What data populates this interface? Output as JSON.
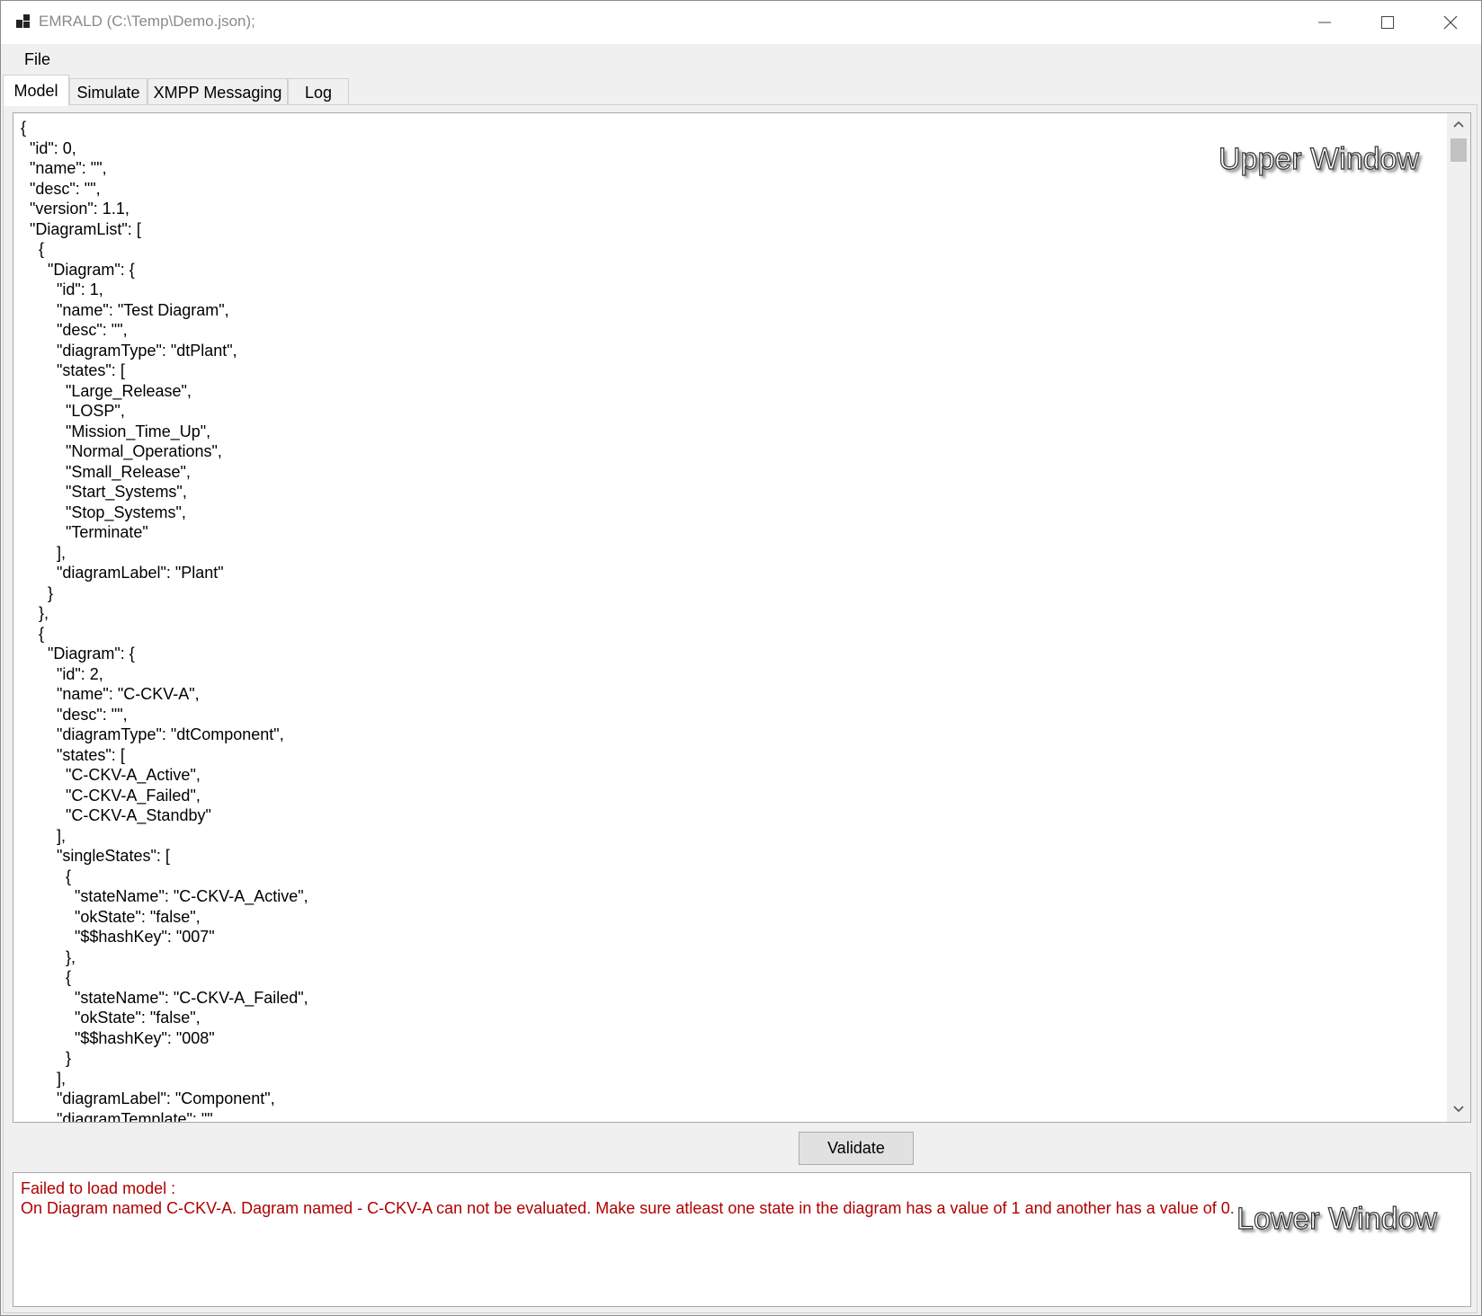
{
  "window": {
    "title": "EMRALD (C:\\Temp\\Demo.json);"
  },
  "menu": {
    "file_label": "File"
  },
  "tabs": [
    {
      "label": "Model",
      "active": true
    },
    {
      "label": "Simulate",
      "active": false
    },
    {
      "label": "XMPP Messaging",
      "active": false
    },
    {
      "label": "Log",
      "active": false
    }
  ],
  "upper": {
    "overlay_label": "Upper Window",
    "json_lines": [
      "{",
      "  \"id\": 0,",
      "  \"name\": \"\",",
      "  \"desc\": \"\",",
      "  \"version\": 1.1,",
      "  \"DiagramList\": [",
      "    {",
      "      \"Diagram\": {",
      "        \"id\": 1,",
      "        \"name\": \"Test Diagram\",",
      "        \"desc\": \"\",",
      "        \"diagramType\": \"dtPlant\",",
      "        \"states\": [",
      "          \"Large_Release\",",
      "          \"LOSP\",",
      "          \"Mission_Time_Up\",",
      "          \"Normal_Operations\",",
      "          \"Small_Release\",",
      "          \"Start_Systems\",",
      "          \"Stop_Systems\",",
      "          \"Terminate\"",
      "        ],",
      "        \"diagramLabel\": \"Plant\"",
      "      }",
      "    },",
      "    {",
      "      \"Diagram\": {",
      "        \"id\": 2,",
      "        \"name\": \"C-CKV-A\",",
      "        \"desc\": \"\",",
      "        \"diagramType\": \"dtComponent\",",
      "        \"states\": [",
      "          \"C-CKV-A_Active\",",
      "          \"C-CKV-A_Failed\",",
      "          \"C-CKV-A_Standby\"",
      "        ],",
      "        \"singleStates\": [",
      "          {",
      "            \"stateName\": \"C-CKV-A_Active\",",
      "            \"okState\": \"false\",",
      "            \"$$hashKey\": \"007\"",
      "          },",
      "          {",
      "            \"stateName\": \"C-CKV-A_Failed\",",
      "            \"okState\": \"false\",",
      "            \"$$hashKey\": \"008\"",
      "          }",
      "        ],",
      "        \"diagramLabel\": \"Component\",",
      "        \"diagramTemplate\": \"\""
    ]
  },
  "validate_label": "Validate",
  "lower": {
    "overlay_label": "Lower Window",
    "line1": "Failed to load model :",
    "line2": "On Diagram named C-CKV-A. Dagram named - C-CKV-A can not be evaluated. Make sure atleast one state in the diagram has a value of 1 and another has a value of 0."
  },
  "colors": {
    "error_text": "#b00000",
    "title_text": "#8a8a8a"
  }
}
